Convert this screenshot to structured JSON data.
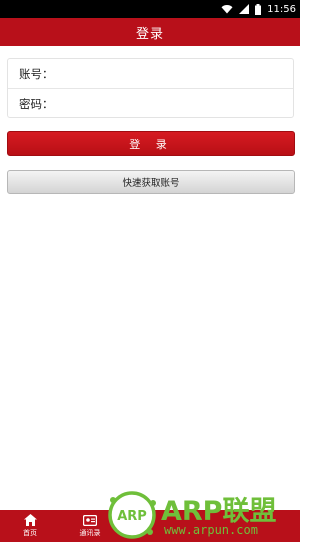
{
  "status_bar": {
    "time": "11:56"
  },
  "header": {
    "title": "登录"
  },
  "form": {
    "account_label": "账号：",
    "account_value": "",
    "password_label": "密码：",
    "password_value": ""
  },
  "actions": {
    "login_label": "登 录",
    "quick_account_label": "快速获取账号"
  },
  "bottom_nav": {
    "items": [
      {
        "label": "首页",
        "icon": "home-icon"
      },
      {
        "label": "通讯录",
        "icon": "contacts-icon"
      }
    ]
  },
  "watermark": {
    "logo_text": "ARP",
    "brand": "ARP联盟",
    "url": "www.arpun.com"
  },
  "colors": {
    "primary_red": "#b8101a",
    "watermark_green": "#6fbf3a"
  }
}
